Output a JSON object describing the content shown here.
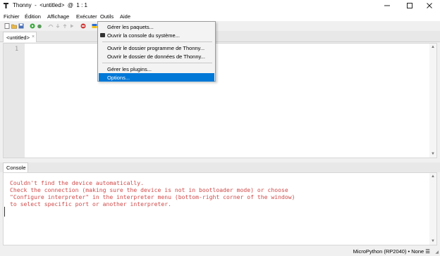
{
  "window": {
    "title": "Thonny  -  <untitled>  @  1 : 1",
    "colors": {
      "selection": "#0078d7",
      "error_text": "#d14a4a"
    }
  },
  "menubar": [
    "Fichier",
    "Édition",
    "Affichage",
    "Exécuter",
    "Outils",
    "Aide"
  ],
  "toolbar_icons": [
    "new-file-icon",
    "open-file-icon",
    "save-icon",
    "run-icon",
    "debug-icon",
    "step-over-icon",
    "step-into-icon",
    "step-out-icon",
    "resume-icon",
    "stop-icon",
    "support-ukraine-icon"
  ],
  "editor": {
    "tab_label": "<untitled>",
    "tab_close": "×",
    "line_numbers": [
      "1"
    ]
  },
  "tools_menu": {
    "items": [
      {
        "label": "Gérer les paquets..."
      },
      {
        "label": "Ouvrir la console du système..."
      },
      {
        "label": "Ouvrir le dossier programme de Thonny..."
      },
      {
        "label": "Ouvrir le dossier de données de Thonny..."
      },
      {
        "label": "Gérer les plugins..."
      },
      {
        "label": "Options...",
        "selected": true
      }
    ]
  },
  "console": {
    "tab_label": "Console",
    "lines": [
      "Couldn't find the device automatically.",
      "Check the connection (making sure the device is not in bootloader mode) or choose",
      "\"Configure interpreter\" in the interpreter menu (bottom-right corner of the window)",
      "to select specific port or another interpreter."
    ]
  },
  "statusbar": {
    "text": "MicroPython (RP2040)  •  None  ☰"
  }
}
